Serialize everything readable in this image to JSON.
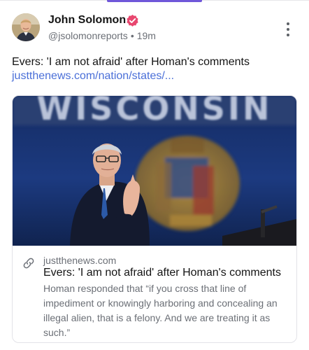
{
  "post": {
    "author": {
      "name": "John Solomon",
      "handle": "@jsolomonreports",
      "time": "19m",
      "separator": "•",
      "verified_color": "#e8476f"
    },
    "text": "Evers: 'I am not afraid' after Homan's comments",
    "link_text": "justthenews.com/nation/states/...",
    "card": {
      "domain": "justthenews.com",
      "title": "Evers: 'I am not afraid' after Homan's comments",
      "description": "Homan responded that “if you cross that line of impediment or knowingly harboring and concealing an illegal alien, that is a felony. And we are treating it as such.”",
      "image_banner_text": "WISCONSIN"
    }
  },
  "colors": {
    "accent": "#6f57d9",
    "link": "#4a6fd8",
    "muted": "#6b6f76"
  },
  "icons": {
    "verified": "verified-badge-icon",
    "more": "more-vertical-icon",
    "link": "link-icon"
  }
}
